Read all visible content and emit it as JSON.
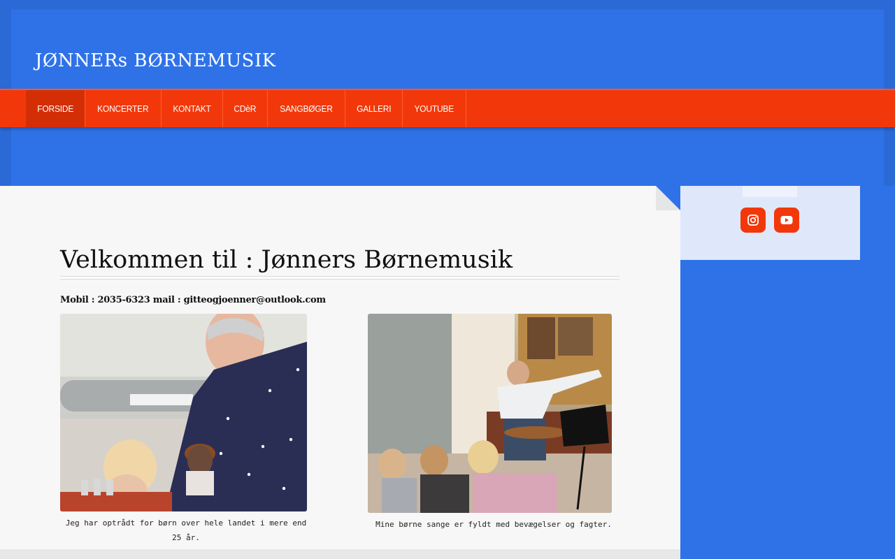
{
  "site": {
    "title": "JØNNERs BØRNEMUSIK"
  },
  "nav": {
    "items": [
      {
        "label": "FORSIDE",
        "active": true
      },
      {
        "label": "KONCERTER"
      },
      {
        "label": "KONTAKT"
      },
      {
        "label": "CDèR"
      },
      {
        "label": "SANGBØGER"
      },
      {
        "label": "GALLERI"
      },
      {
        "label": "YOUTUBE"
      }
    ]
  },
  "main": {
    "heading": "Velkommen til : Jønners Børnemusik",
    "contact": "Mobil : 2035-6323 mail : gitteogjoenner@outlook.com",
    "photos": [
      {
        "caption": "Jeg har optrådt for børn over hele landet i mere end 25 år."
      },
      {
        "caption": "Mine børne sange er fyldt med bevægelser og fagter."
      }
    ]
  },
  "sidebar": {
    "social": [
      {
        "icon": "instagram-icon"
      },
      {
        "icon": "youtube-icon"
      }
    ]
  },
  "colors": {
    "background": "#2f72e8",
    "nav": "#f2380a",
    "nav_active": "#d42e06",
    "content": "#f7f7f7",
    "sidebar": "#dfe8fb"
  }
}
